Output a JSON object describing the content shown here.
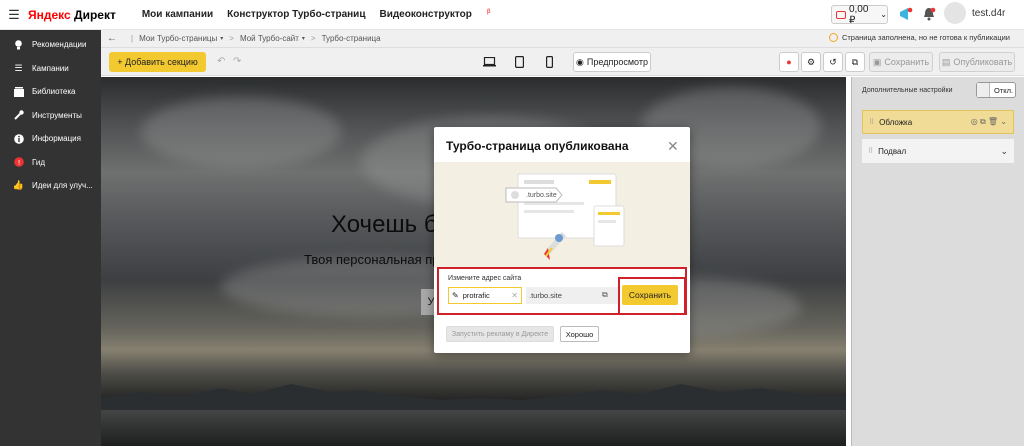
{
  "header": {
    "logo_ya": "Яндекс",
    "logo_rest": " Директ",
    "nav": [
      "Мои кампании",
      "Конструктор Турбо-страниц",
      "Видеоконструктор"
    ],
    "nav_beta_mark": "β",
    "balance": "0,00 ₽",
    "username": "test.d4r"
  },
  "sidebar": {
    "items": [
      {
        "label": "Рекомендации",
        "icon": "lightbulb-icon"
      },
      {
        "label": "Кампании",
        "icon": "list-icon"
      },
      {
        "label": "Библиотека",
        "icon": "library-icon"
      },
      {
        "label": "Инструменты",
        "icon": "wrench-icon"
      },
      {
        "label": "Информация",
        "icon": "info-icon"
      },
      {
        "label": "Гид",
        "icon": "guide-icon"
      },
      {
        "label": "Идеи для улуч...",
        "icon": "thumbs-up-icon"
      }
    ]
  },
  "breadcrumbs": {
    "items": [
      "Мои Турбо-страницы",
      "Мой Турбо-сайт",
      "Турбо-страница"
    ],
    "status": "Страница заполнена, но не готова к публикации"
  },
  "toolbar": {
    "add_section": "+ Добавить секцию",
    "preview": "Предпросмотр",
    "save": "Сохранить",
    "publish": "Опубликовать"
  },
  "canvas": {
    "hero_title": "Хочешь б",
    "hero_subtitle": "Твоя персональная пр",
    "hero_button": "У"
  },
  "right_panel": {
    "settings_label": "Дополнительные настройки",
    "toggle_label": "Откл.",
    "sections": [
      "Обложка",
      "Подвал"
    ]
  },
  "modal": {
    "title": "Турбо-страница опубликована",
    "illustration_label": ".turbo.site",
    "url_label": "Измените адрес сайта",
    "url_value": "protrafic",
    "url_suffix": ".turbo.site",
    "save_button": "Сохранить",
    "run_ads_button": "Запустить рекламу в Директе",
    "ok_button": "Хорошо"
  },
  "colors": {
    "accent_yellow": "#f3c930",
    "highlight_red": "#d0202a",
    "sidebar_bg": "#333333"
  }
}
